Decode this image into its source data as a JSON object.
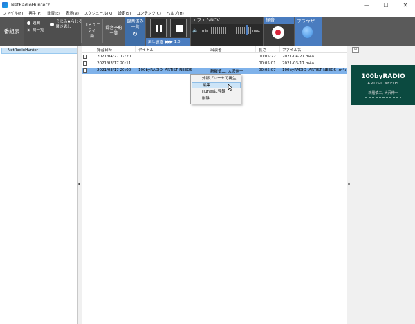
{
  "window": {
    "title": "NetRadioHunter2",
    "minimize_glyph": "—",
    "maximize_glyph": "☐",
    "close_glyph": "✕"
  },
  "menu": [
    "ファイル(F)",
    "再生(P)",
    "録音(E)",
    "表示(V)",
    "スケジュール(K)",
    "設定(S)",
    "コンテンツ(C)",
    "ヘルプ(H)"
  ],
  "toolbar": {
    "bangumi_label": "番組表",
    "radio_weekly": "週間",
    "radio_station_list": "局一覧",
    "radio_radiru_1": "らじる★らじる",
    "radio_radiru_2": "聞き逃し",
    "community_1": "コミュニティ",
    "community_2": "局",
    "reserve_1": "録音予約",
    "reserve_2": "一覧",
    "recorded_1": "録音済み",
    "recorded_2": "一覧",
    "refresh_glyph": "↻",
    "speed_label": "再生速度",
    "speed_arrows": "▶▶▶",
    "speed_value": "1.0",
    "station_name": "エフエムNCV",
    "speaker_glyph": "🔈",
    "volume_min": "min",
    "volume_max": "max",
    "volume_level": 0.88,
    "record_label": "録音",
    "browser_label": "ブラウザ"
  },
  "tree": {
    "items": [
      "NetRadioHunter"
    ]
  },
  "list": {
    "columns": [
      "録音日時",
      "タイトル",
      "出演者",
      "長さ",
      "ファイル名"
    ],
    "rows": [
      {
        "date": "2021/04/27 17:20",
        "title": "",
        "performer": "",
        "length": "00:05:22",
        "file": "2021-04-27.m4a",
        "selected": false
      },
      {
        "date": "2021/03/17 20:11",
        "title": "",
        "performer": "",
        "length": "00:05:01",
        "file": "2021-03-17.m4a",
        "selected": false
      },
      {
        "date": "2021/03/17 20:00",
        "title": "100byRADIO -ARTIST NEEDS-",
        "performer": "新羅慎二, 大沢伸一",
        "length": "00:05:07",
        "file": "100byRADIO -ARTIST NEEDS-.m4a",
        "selected": true
      }
    ]
  },
  "context_menu": {
    "items": [
      "外部プレーヤで再生",
      "編集...",
      "iTunesに登録",
      "削除"
    ],
    "hover_index": 1
  },
  "right_pane": {
    "toggle_glyph": "⊞",
    "thumbnail": {
      "line1": "100byRADIO",
      "line2": "ARTIST NEEDS",
      "line3": "新羅慎二, 大沢伸一"
    }
  },
  "colors": {
    "toolbar_bg": "#5a5a5a",
    "accent_blue": "#4a7cbf",
    "selection": "#7fb2ea",
    "record_red": "#d8243a",
    "thumb_bg": "#0b4a40"
  }
}
